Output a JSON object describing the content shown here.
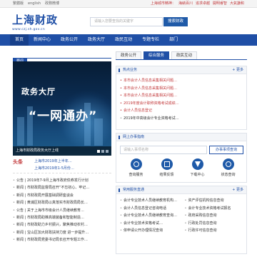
{
  "topbar": {
    "links": [
      "繁體版",
      "english",
      "政務微博"
    ],
    "right": [
      "上海城市精神：",
      "海納百川",
      "追求卓越",
      "開明睿智",
      "大氣謙和"
    ]
  },
  "header": {
    "logo_text": "上海财政",
    "logo_url": "www.czj.sh.gov.cn",
    "search_placeholder": "请输入您要查找的关键字",
    "search_button": "搜索财政"
  },
  "nav": [
    "首页",
    "新闻中心",
    "政务公开",
    "政务大厅",
    "政民互动",
    "专题专栏",
    "部门"
  ],
  "left": {
    "section_tag": "要闻",
    "banner": {
      "title_small": "政务大厅",
      "title_big": "“一网通办”",
      "caption": "上海市财政局政务大厅上线"
    },
    "headline": {
      "label": "头条",
      "line1": "上海市2019年上半年…",
      "line2": "上海市2019年1-5月份…"
    },
    "news": [
      {
        "cat": "公告",
        "text": "2019年7-9月上海市政府债券发行计划"
      },
      {
        "cat": "新闻",
        "text": "市财政局监督局召开“不忘初心、牢记…"
      },
      {
        "cat": "新闻",
        "text": "市财政局开展基础调研座谈会"
      },
      {
        "cat": "新闻",
        "text": "黄浦区财政局以真落实市财政局局长…"
      },
      {
        "cat": "公告",
        "text": "关于上海市市级会计人员继续教育…"
      },
      {
        "cat": "新闻",
        "text": "市财政局助推高端装备和智能制造…"
      },
      {
        "cat": "新闻",
        "text": "市财政助力乡村振兴，聚焦推动农村…"
      },
      {
        "cat": "新闻",
        "text": "宝山区加大财政扶持力度 进一步提升…"
      },
      {
        "cat": "新闻",
        "text": "市财政局党委书记局长召开专题工作…"
      }
    ]
  },
  "right": {
    "tabs": [
      "政务公开",
      "综合服务",
      "政民互动"
    ],
    "active_tab": 1,
    "hot": {
      "title": "热点业务",
      "more": "更多",
      "items": [
        {
          "text": "本市会计人员信息采集相关问题…",
          "style": "red"
        },
        {
          "text": "本市会计人员信息采集相关问题…",
          "style": "red"
        },
        {
          "text": "本市会计人员信息采集相关问题…",
          "style": "red"
        },
        {
          "text": "2019年度会计职称资格考试成绩…",
          "style": "red"
        },
        {
          "text": "会计人员信息登记",
          "style": "red"
        },
        {
          "text": "2019年中高级会计专业资格考试…",
          "style": "dark"
        }
      ]
    },
    "service": {
      "title": "网上办事指南",
      "placeholder": "请输入事项名称",
      "button": "办事事项查询",
      "icons": [
        {
          "name": "inquiry",
          "label": "查询服务"
        },
        {
          "name": "results",
          "label": "结果反馈"
        },
        {
          "name": "download",
          "label": "下载中心"
        },
        {
          "name": "status",
          "label": "状态查询"
        }
      ]
    },
    "faq": {
      "title": "常用服务直通",
      "more": "更多",
      "items": [
        "会计专业技术人员继续教育机构…",
        "资产评估机构信息查询",
        "会计人员信息登记咨询电话",
        "会计专业技术资格考试报名",
        "会计专业技术人员继续教育查询…",
        "政府采购信息查询",
        "会计专业技术资格考试…",
        "行政处罚信息查询",
        "依申请公开办理情况查询",
        "行政许可信息查询"
      ]
    }
  }
}
